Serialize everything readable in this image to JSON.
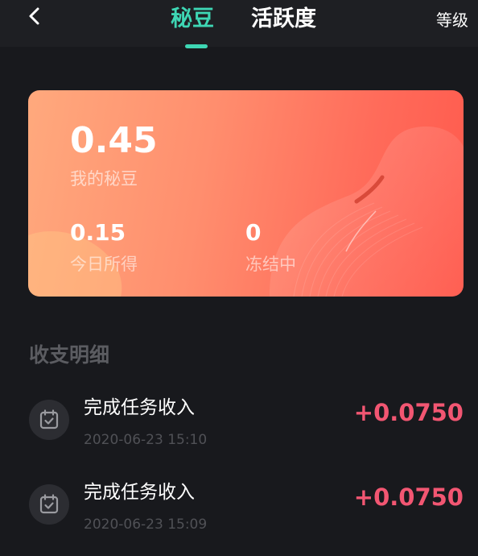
{
  "header": {
    "tabs": [
      {
        "label": "秘豆",
        "active": true
      },
      {
        "label": "活跃度",
        "active": false
      }
    ],
    "right_link": "等级"
  },
  "balance": {
    "total_value": "0.45",
    "total_label": "我的秘豆",
    "today_value": "0.15",
    "today_label": "今日所得",
    "frozen_value": "0",
    "frozen_label": "冻结中"
  },
  "details": {
    "title": "收支明细",
    "records": [
      {
        "title": "完成任务收入",
        "time": "2020-06-23 15:10",
        "amount": "+0.0750"
      },
      {
        "title": "完成任务收入",
        "time": "2020-06-23 15:09",
        "amount": "+0.0750"
      }
    ]
  },
  "colors": {
    "accent": "#3ed6b4",
    "amount": "#f25672",
    "background": "#18191d",
    "card_start": "#ffa97d",
    "card_end": "#ff5a4d"
  },
  "icons": {
    "back": "back-arrow-icon",
    "record": "calendar-check-icon"
  }
}
